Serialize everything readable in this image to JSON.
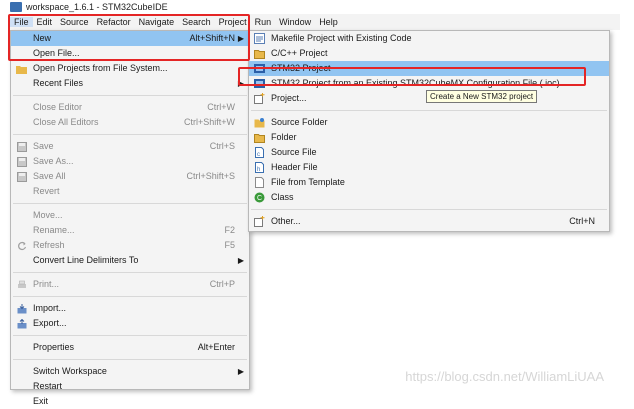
{
  "window": {
    "title": "workspace_1.6.1 - STM32CubeIDE"
  },
  "menubar": [
    "File",
    "Edit",
    "Source",
    "Refactor",
    "Navigate",
    "Search",
    "Project",
    "Run",
    "Window",
    "Help"
  ],
  "file_menu": {
    "new": {
      "label": "New",
      "accel": "Alt+Shift+N"
    },
    "open_file": "Open File...",
    "open_projects": "Open Projects from File System...",
    "recent_files": "Recent Files",
    "close_editor": {
      "label": "Close Editor",
      "accel": "Ctrl+W"
    },
    "close_all_editors": {
      "label": "Close All Editors",
      "accel": "Ctrl+Shift+W"
    },
    "save": {
      "label": "Save",
      "accel": "Ctrl+S"
    },
    "save_as": "Save As...",
    "save_all": {
      "label": "Save All",
      "accel": "Ctrl+Shift+S"
    },
    "revert": "Revert",
    "move": "Move...",
    "rename": {
      "label": "Rename...",
      "accel": "F2"
    },
    "refresh": {
      "label": "Refresh",
      "accel": "F5"
    },
    "convert_line_delimiters": "Convert Line Delimiters To",
    "print": {
      "label": "Print...",
      "accel": "Ctrl+P"
    },
    "import": "Import...",
    "export": "Export...",
    "properties": {
      "label": "Properties",
      "accel": "Alt+Enter"
    },
    "switch_workspace": "Switch Workspace",
    "restart": "Restart",
    "exit": "Exit"
  },
  "new_submenu": {
    "makefile_project": "Makefile Project with Existing Code",
    "cpp_project": "C/C++ Project",
    "stm32_project": "STM32 Project",
    "stm32_from_ioc": "STM32 Project from an Existing STM32CubeMX Configuration File (.ioc)",
    "project": "Project...",
    "source_folder": "Source Folder",
    "folder": "Folder",
    "source_file": "Source File",
    "header_file": "Header File",
    "file_from_template": "File from Template",
    "class": "Class",
    "other": {
      "label": "Other...",
      "accel": "Ctrl+N"
    }
  },
  "tooltip": "Create a New STM32 project",
  "watermark": "https://blog.csdn.net/WilliamLiUAA",
  "colors": {
    "highlight": "#91c4f1",
    "red_box": "#e42525",
    "menu_bg": "#f4f4f4"
  }
}
